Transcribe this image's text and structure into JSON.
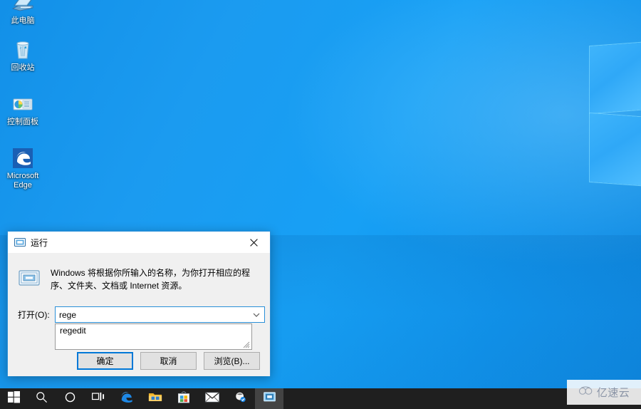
{
  "desktop": {
    "icons": [
      {
        "name": "this-pc",
        "label": "此电脑",
        "icon": "computer-icon"
      },
      {
        "name": "recycle-bin",
        "label": "回收站",
        "icon": "recycle-bin-icon"
      },
      {
        "name": "control-panel",
        "label": "控制面板",
        "icon": "control-panel-icon"
      },
      {
        "name": "microsoft-edge",
        "label": "Microsoft Edge",
        "icon": "edge-icon"
      }
    ],
    "wallpaper": {
      "name": "windows-10-hero",
      "background_color": "#1b9bf0",
      "logo_color": "#3fb4fb"
    }
  },
  "run_dialog": {
    "title": "运行",
    "title_icon": "run-window-icon",
    "close_label": "×",
    "description": "Windows 将根据你所输入的名称，为你打开相应的程序、文件夹、文档或 Internet 资源。",
    "open_label": "打开(O):",
    "input": {
      "value": "rege",
      "placeholder": ""
    },
    "suggestions": [
      "regedit"
    ],
    "buttons": {
      "ok": "确定",
      "cancel": "取消",
      "browse": "浏览(B)..."
    },
    "accent_color": "#0078d7",
    "background_color": "#f0f0f0"
  },
  "taskbar": {
    "background_color": "#1f1f1f",
    "items": [
      {
        "name": "start",
        "icon": "windows-start-icon",
        "active": false
      },
      {
        "name": "search",
        "icon": "search-icon",
        "active": false
      },
      {
        "name": "cortana",
        "icon": "cortana-circle-icon",
        "active": false
      },
      {
        "name": "task-view",
        "icon": "task-view-icon",
        "active": false
      },
      {
        "name": "edge",
        "icon": "edge-icon",
        "active": false
      },
      {
        "name": "file-explorer",
        "icon": "folder-icon",
        "active": false
      },
      {
        "name": "microsoft-store",
        "icon": "store-icon",
        "active": false
      },
      {
        "name": "mail",
        "icon": "mail-icon",
        "active": false
      },
      {
        "name": "pinned-app",
        "icon": "app-icon",
        "active": false
      },
      {
        "name": "run-window",
        "icon": "run-window-icon",
        "active": true
      }
    ]
  },
  "watermark": {
    "text": "亿速云",
    "icon": "cloud-icon"
  }
}
